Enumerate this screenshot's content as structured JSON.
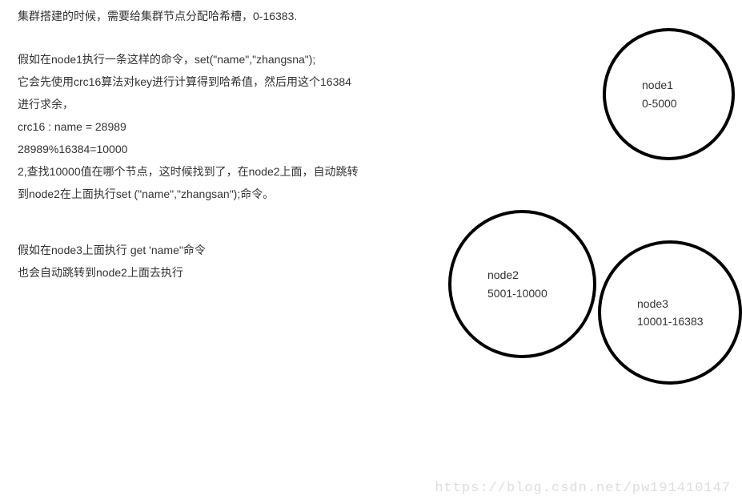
{
  "text": {
    "block1": {
      "line1": "集群搭建的时候，需要给集群节点分配哈希槽，0-16383."
    },
    "block2": {
      "line1": "假如在node1执行一条这样的命令，set(\"name\",\"zhangsna\");",
      "line2": "它会先使用crc16算法对key进行计算得到哈希值，然后用这个16384",
      "line3": "进行求余，",
      "line4": "crc16 : name = 28989",
      "line5": "28989%16384=10000",
      "line6": "2,查找10000值在哪个节点，这时候找到了，在node2上面，自动跳转",
      "line7": "到node2在上面执行set (\"name\",\"zhangsan\");命令。"
    },
    "block3": {
      "line1": "假如在node3上面执行 get 'name\"命令",
      "line2": "也会自动跳转到node2上面去执行"
    }
  },
  "nodes": {
    "node1": {
      "name": "node1",
      "range": "0-5000"
    },
    "node2": {
      "name": "node2",
      "range": "5001-10000"
    },
    "node3": {
      "name": "node3",
      "range": "10001-16383"
    }
  },
  "watermark": "https://blog.csdn.net/pw191410147",
  "chart_data": {
    "type": "diagram",
    "title": "Redis Cluster Hash Slot Distribution",
    "total_slots": 16384,
    "slot_range": "0-16383",
    "hash_algorithm": "crc16",
    "example": {
      "key": "name",
      "crc16_value": 28989,
      "slot": 10000,
      "target_node": "node2"
    },
    "nodes": [
      {
        "name": "node1",
        "slot_start": 0,
        "slot_end": 5000
      },
      {
        "name": "node2",
        "slot_start": 5001,
        "slot_end": 10000
      },
      {
        "name": "node3",
        "slot_start": 10001,
        "slot_end": 16383
      }
    ]
  }
}
